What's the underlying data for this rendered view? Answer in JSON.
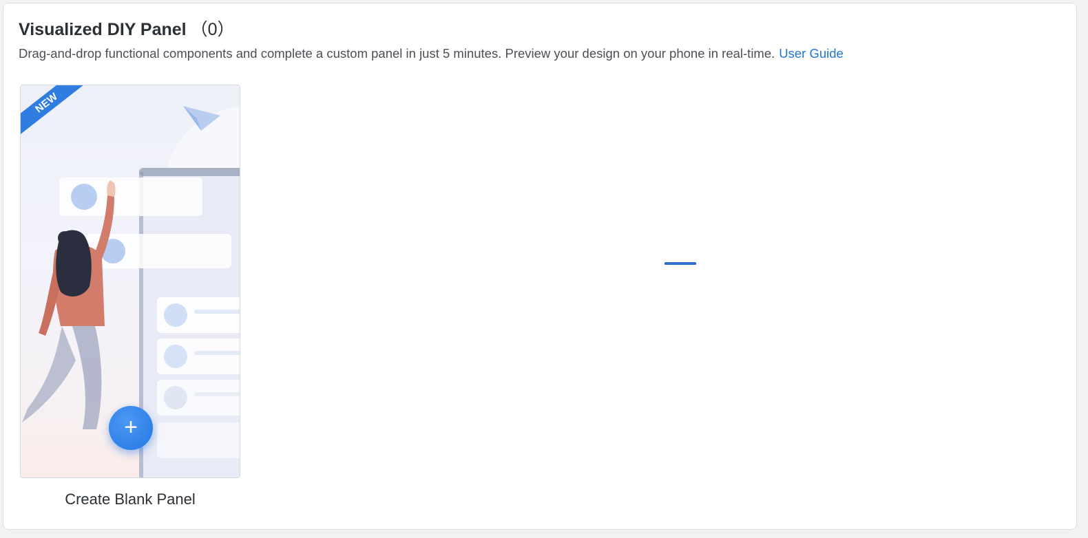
{
  "header": {
    "title": "Visualized DIY Panel",
    "count": "（0）",
    "description": "Drag-and-drop functional components and complete a custom panel in just 5 minutes. Preview your design on your phone in real-time.",
    "guide_link": "User Guide"
  },
  "card": {
    "badge": "NEW",
    "add_symbol": "+",
    "label": "Create Blank Panel",
    "icons": [
      "paper-plane-icon",
      "plus-icon"
    ]
  },
  "colors": {
    "accent": "#1f75d8",
    "badge": "#2f7de1",
    "add_button": "#2477e4",
    "loader": "#2f6fd0"
  }
}
